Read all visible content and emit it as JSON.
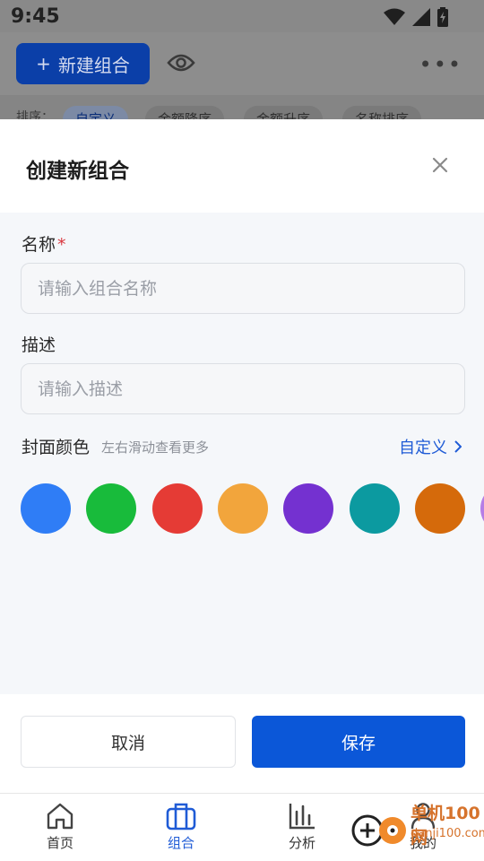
{
  "status_bar": {
    "time": "9:45"
  },
  "background": {
    "new_button_label": "新建组合",
    "new_button_plus": "+",
    "sort_label": "排序：",
    "sort_chips": [
      "自定义",
      "金额降序",
      "金额升序",
      "名称排序"
    ]
  },
  "modal": {
    "title": "创建新组合",
    "name_label": "名称",
    "required_mark": "*",
    "name_placeholder": "请输入组合名称",
    "desc_label": "描述",
    "desc_placeholder": "请输入描述",
    "cover_label": "封面颜色",
    "cover_hint": "左右滑动查看更多",
    "custom_link": "自定义",
    "swatches": [
      "#2f7df6",
      "#18bb3b",
      "#e53b35",
      "#f2a53c",
      "#7431d0",
      "#0c9aa0",
      "#d56a0b",
      "#b57de6"
    ],
    "cancel_label": "取消",
    "save_label": "保存"
  },
  "tabbar": {
    "items": [
      {
        "label": "首页",
        "icon": "home-icon"
      },
      {
        "label": "组合",
        "icon": "briefcase-icon"
      },
      {
        "label": "分析",
        "icon": "bar-chart-icon"
      },
      {
        "label": "我的",
        "icon": "user-icon"
      }
    ],
    "active_index": 1
  },
  "watermark": {
    "text": "单机100网",
    "url": "danji100.com"
  },
  "colors": {
    "accent": "#0b57d8",
    "link": "#1f5bd6",
    "required": "#d9363e"
  }
}
